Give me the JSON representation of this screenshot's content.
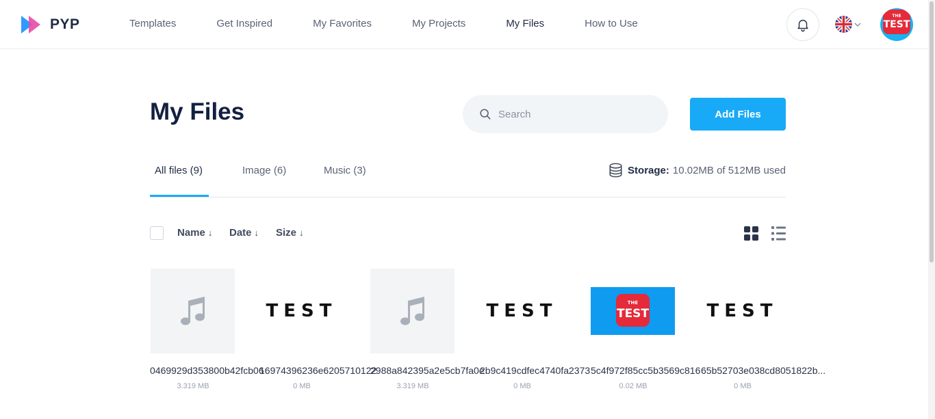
{
  "brand": {
    "name": "PYP"
  },
  "nav": [
    {
      "label": "Templates",
      "active": false
    },
    {
      "label": "Get Inspired",
      "active": false
    },
    {
      "label": "My Favorites",
      "active": false
    },
    {
      "label": "My Projects",
      "active": false
    },
    {
      "label": "My Files",
      "active": true
    },
    {
      "label": "How to Use",
      "active": false
    }
  ],
  "header": {
    "avatar_text": "TEST",
    "avatar_small_text": "THE",
    "language_icon": "uk-flag-icon"
  },
  "page": {
    "title": "My Files"
  },
  "search": {
    "placeholder": "Search",
    "value": ""
  },
  "add_button": {
    "label": "Add Files"
  },
  "tabs": [
    {
      "label": "All files (9)",
      "active": true
    },
    {
      "label": "Image (6)",
      "active": false
    },
    {
      "label": "Music (3)",
      "active": false
    }
  ],
  "storage": {
    "label": "Storage:",
    "value": "10.02MB of 512MB used"
  },
  "sort": {
    "name": "Name",
    "date": "Date",
    "size": "Size",
    "arrow": "↓"
  },
  "files": [
    {
      "name": "0469929d353800b42fcb06",
      "size": "3.319 MB",
      "kind": "music"
    },
    {
      "name": "16974396236e6205710122",
      "size": "0 MB",
      "kind": "test-word",
      "preview": "TEST"
    },
    {
      "name": "2988a842395a2e5cb7fa0e",
      "size": "3.319 MB",
      "kind": "music"
    },
    {
      "name": "2b9c419cdfec4740fa2373",
      "size": "0 MB",
      "kind": "test-word",
      "preview": "TEST"
    },
    {
      "name": "5c4f972f85cc5b3569c816",
      "size": "0.02 MB",
      "kind": "test-logo",
      "preview": "TEST",
      "preview_small": "THE"
    },
    {
      "name": "65b52703e038cd8051822b...",
      "size": "0 MB",
      "kind": "test-word",
      "preview": "TEST"
    }
  ],
  "colors": {
    "accent": "#19aaf7",
    "title": "#132040",
    "logo_red": "#e52a3a",
    "logo_blue": "#1ab2f2"
  }
}
